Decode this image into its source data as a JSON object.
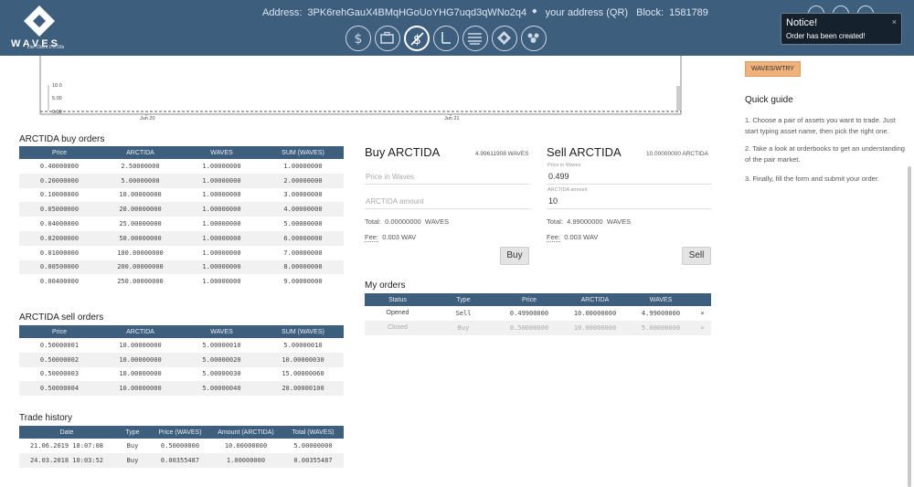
{
  "header": {
    "logo_text": "WAVES",
    "logo_subtitle": "Lite Client 0.5.18a",
    "address_label": "Address:",
    "address_value": "3PK6rehGauX4BMqHGoUoYHG7uqd3qWNo2q4",
    "address_link": "your address (QR)",
    "block_label": "Block:",
    "block_value": "1581789",
    "nav_icons": [
      "wallet-icon",
      "portfolio-icon",
      "dex-icon",
      "leasing-icon",
      "history-icon",
      "tokens-icon",
      "community-icon"
    ]
  },
  "notice": {
    "title": "Notice!",
    "message": "Order has been created!",
    "close": "×"
  },
  "chart": {
    "y_ticks": [
      "10.0",
      "5.00",
      "0.00"
    ],
    "x_ticks": [
      "Jun 20",
      "Jun 21"
    ]
  },
  "buy_orders": {
    "title": "ARCTIDA buy orders",
    "headers": [
      "Price",
      "ARCTIDA",
      "WAVES",
      "SUM (WAVES)"
    ],
    "rows": [
      [
        "0.40000000",
        "2.50000000",
        "1.00000000",
        "1.00000000"
      ],
      [
        "0.20000000",
        "5.00000000",
        "1.00000000",
        "2.00000000"
      ],
      [
        "0.10000000",
        "10.00000000",
        "1.00000000",
        "3.00000000"
      ],
      [
        "0.05000000",
        "20.00000000",
        "1.00000000",
        "4.00000000"
      ],
      [
        "0.04000000",
        "25.00000000",
        "1.00000000",
        "5.00000000"
      ],
      [
        "0.02000000",
        "50.00000000",
        "1.00000000",
        "6.00000000"
      ],
      [
        "0.01000000",
        "100.00000000",
        "1.00000000",
        "7.00000000"
      ],
      [
        "0.00500000",
        "200.00000000",
        "1.00000000",
        "8.00000000"
      ],
      [
        "0.00400000",
        "250.00000000",
        "1.00000000",
        "9.00000000"
      ]
    ]
  },
  "sell_orders": {
    "title": "ARCTIDA sell orders",
    "headers": [
      "Price",
      "ARCTIDA",
      "WAVES",
      "SUM (WAVES)"
    ],
    "rows": [
      [
        "0.50000001",
        "10.00000000",
        "5.00000010",
        "5.00000010"
      ],
      [
        "0.50000002",
        "10.00000000",
        "5.00000020",
        "10.00000030"
      ],
      [
        "0.50000003",
        "10.00000000",
        "5.00000030",
        "15.00000060"
      ],
      [
        "0.50000004",
        "10.00000000",
        "5.00000040",
        "20.00000100"
      ]
    ]
  },
  "trade_history": {
    "title": "Trade history",
    "headers": [
      "Date",
      "Type",
      "Price (WAVES)",
      "Amount (ARCTIDA)",
      "Total (WAVES)"
    ],
    "rows": [
      [
        "21.06.2019 18:07:08",
        "Buy",
        "0.50000000",
        "10.00000000",
        "5.00000000"
      ],
      [
        "24.03.2018 10:03:52",
        "Buy",
        "0.00355487",
        "1.00000000",
        "0.00355487"
      ]
    ]
  },
  "buy_form": {
    "title": "Buy ARCTIDA",
    "balance": "4.99611908 WAVES",
    "price_placeholder": "Price in Waves",
    "amount_placeholder": "ARCTIDA amount",
    "total_label": "Total:",
    "total_value": "0.00000000",
    "total_unit": "WAVES",
    "fee_label": "Fee:",
    "fee_value": "0.003 WAV",
    "button": "Buy"
  },
  "sell_form": {
    "title": "Sell ARCTIDA",
    "balance": "10.00000000 ARCTIDA",
    "price_label": "Price in Waves",
    "price_value": "0.499",
    "amount_label": "ARCTIDA amount",
    "amount_value": "10",
    "total_label": "Total:",
    "total_value": "4.99000000",
    "total_unit": "WAVES",
    "fee_label": "Fee:",
    "fee_value": "0.003 WAV",
    "button": "Sell"
  },
  "my_orders": {
    "title": "My orders",
    "headers": [
      "Status",
      "Type",
      "Price",
      "ARCTIDA",
      "WAVES"
    ],
    "rows": [
      {
        "status": "Opened",
        "type": "Sell",
        "price": "0.49900000",
        "arctida": "10.00000000",
        "waves": "4.99000000",
        "action": "×"
      },
      {
        "status": "Closed",
        "type": "Buy",
        "price": "0.50000000",
        "arctida": "10.00000000",
        "waves": "5.00000000",
        "action": "×"
      }
    ]
  },
  "right_panel": {
    "pair": "WAVES/WTRY",
    "quick_guide_title": "Quick guide",
    "steps": [
      "1. Choose a pair of assets you want to trade. Just start typing asset name, then pick the right one.",
      "2. Take a look at orderbooks to get an understanding of the pair market.",
      "3. Finally, fill the form and submit your order."
    ]
  },
  "colors": {
    "header_bg": "#3e5e7e",
    "table_header": "#3e5e7e",
    "accent": "#f0b27a",
    "sell": "#d08a2a",
    "buy": "#2e5e8e"
  }
}
